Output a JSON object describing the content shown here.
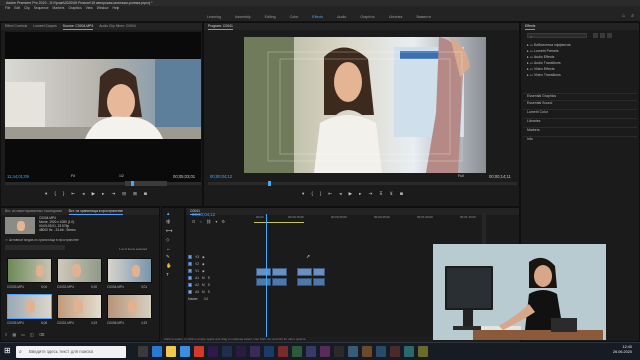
{
  "app": {
    "title": "Adobe Premiere Pro 2019 - D:\\Уроки\\2020\\06 Posture\\15 авторская-монтажи-ролика.prproj *"
  },
  "menu": [
    "File",
    "Edit",
    "Clip",
    "Sequence",
    "Markers",
    "Graphics",
    "View",
    "Window",
    "Help"
  ],
  "workspaces": {
    "tabs": [
      "Learning",
      "Assembly",
      "Editing",
      "Color",
      "Effects",
      "Audio",
      "Graphics",
      "Libraries",
      "Вывести"
    ],
    "active": "Effects"
  },
  "source_panel": {
    "tabs": [
      "Effect Controls",
      "Lumetri Scopes",
      "Source: C0004.MP4",
      "Audio Clip Mixer: C0004"
    ],
    "active_tab": "Source: C0004.MP4",
    "timecode_left": "11;44;01;09",
    "fit": "Fit",
    "ratio": "1/2",
    "timecode_right": "00;05;03;01"
  },
  "program_panel": {
    "tabs": [
      "Program: C0041"
    ],
    "active_tab": "Program: C0041",
    "timecode_left": "00;00;04;12",
    "fit": "Full",
    "timecode_right": "00;00;14;11"
  },
  "effects_panel": {
    "title": "Effects",
    "search_placeholder": "",
    "items": [
      "Lumetri Presets",
      "Audio Effects",
      "Audio Transitions",
      "Video Effects",
      "Video Transitions"
    ],
    "header_item": "Библиотека эффектов",
    "sections": [
      "Essential Graphics",
      "Essential Sound",
      "Lumetri Color",
      "Libraries",
      "Markers",
      "Info"
    ]
  },
  "project_panel": {
    "tabs": [
      "Вст. из смонтированных последоват.",
      "Вст. из хранилища в пространстве"
    ],
    "clip_info": [
      "C0004.MP4",
      "Movie, 1920 x 1080 (1.0)",
      "00;05;03;01, 23.976p",
      "48000 Hz - 24-bit - Stereo"
    ],
    "bin_path": "Активные медиа из хранилища в пространстве",
    "count": "1 из 6 items selected",
    "thumbs": [
      {
        "name": "C0003.MP4",
        "dur": "5;04"
      },
      {
        "name": "C0002.MP4",
        "dur": "5;20"
      },
      {
        "name": "C0004.MP4",
        "dur": "3;01"
      },
      {
        "name": "C0005.MP4",
        "dur": "5;06"
      },
      {
        "name": "C0001.MP4",
        "dur": "4;19"
      },
      {
        "name": "C0006.MP4",
        "dur": "4;19"
      }
    ]
  },
  "timeline_panel": {
    "tab": "C0041",
    "timecode": "00;00;04;12",
    "ruler": [
      "00;00",
      "00;00;15;00",
      "00;00;30;00",
      "00;00;45;00",
      "00;01;00;00",
      "00;01;15;00"
    ],
    "tracks": [
      "V3",
      "V2",
      "V1",
      "A1",
      "A2",
      "A3"
    ],
    "master_label": "Master",
    "master_value": "0.0"
  },
  "status_bar": {
    "text": "Click to select, or click in empty space and drag to marquee select. Use Shift, Alt, and Ctrl for other options."
  },
  "taskbar": {
    "search_placeholder": "Введите здесь текст для поиска",
    "time": "12:40",
    "date": "26.06.2020"
  },
  "colors": {
    "accent": "#4da3ff",
    "panel_bg": "#1b1b1b",
    "clip_blue": "#6b8fbf"
  }
}
